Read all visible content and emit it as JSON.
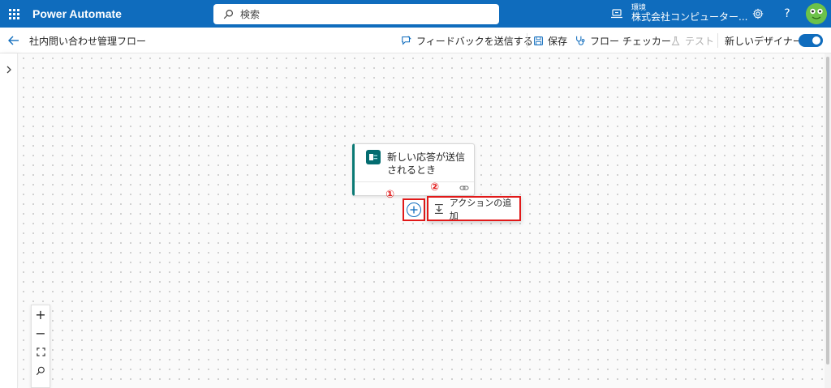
{
  "header": {
    "app_name": "Power Automate",
    "search_placeholder": "検索",
    "environment_label": "環境",
    "environment_name": "株式会社コンピューター...",
    "brand_color": "#0f6cbd"
  },
  "toolbar": {
    "flow_name": "社内問い合わせ管理フロー",
    "feedback_label": "フィードバックを送信する",
    "save_label": "保存",
    "checker_label": "フロー チェッカー",
    "test_label": "テスト",
    "new_designer_label": "新しいデザイナー",
    "new_designer_enabled": true
  },
  "canvas": {
    "trigger_card": {
      "title": "新しい応答が送信されるとき",
      "icon": "forms-icon",
      "accent_color": "#0b7a75"
    },
    "add_action_label": "アクションの追加",
    "markers": [
      "①",
      "②"
    ],
    "annotation_color": "#e11919"
  },
  "zoom_controls": {
    "zoom_in": "+",
    "zoom_out": "−"
  }
}
